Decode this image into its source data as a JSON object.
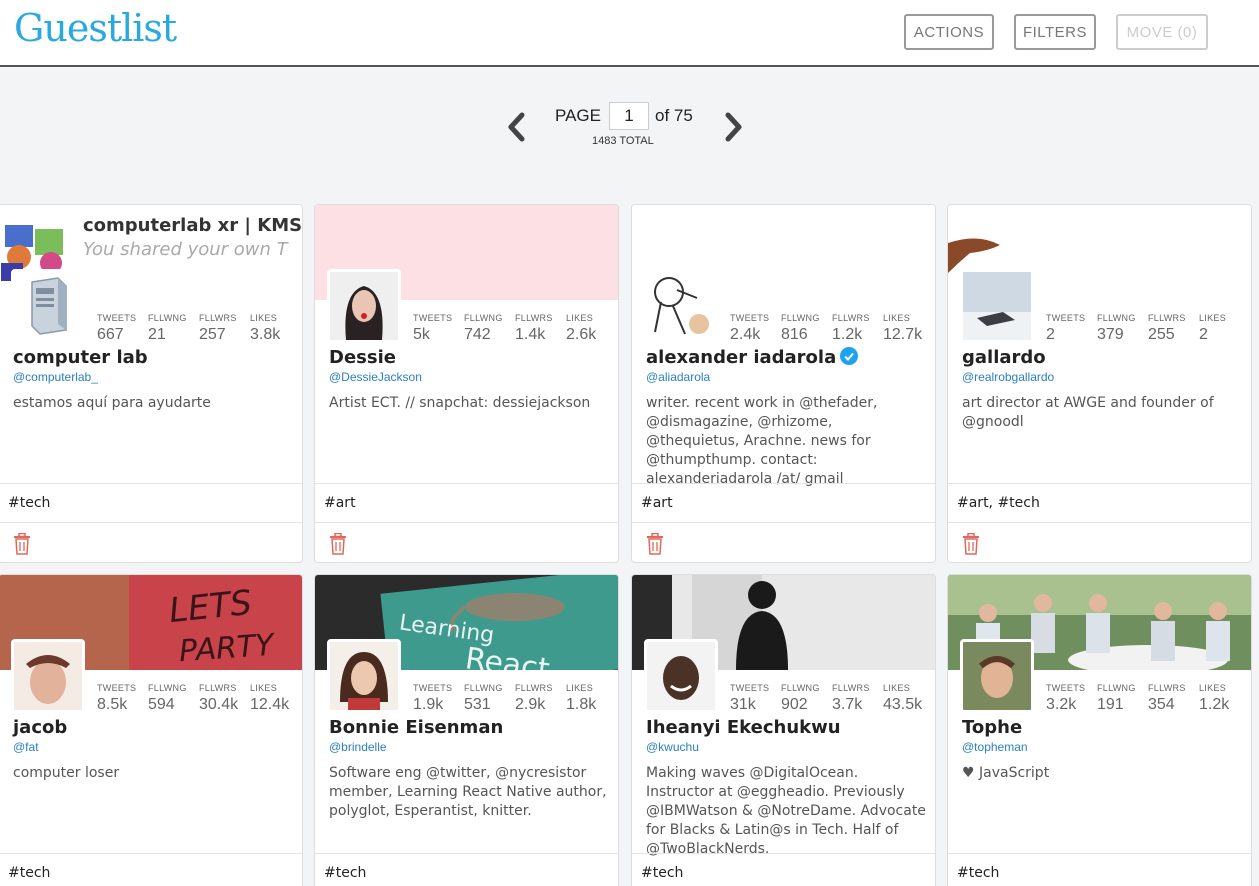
{
  "app": {
    "title": "Guestlist"
  },
  "header": {
    "actions_label": "ACTIONS",
    "filters_label": "FILTERS",
    "move_label": "MOVE (0)"
  },
  "pagination": {
    "page_label": "PAGE",
    "current_page": "1",
    "of_text": "of 75",
    "total_text": "1483 TOTAL"
  },
  "stat_labels": {
    "tweets": "TWEETS",
    "following": "FLLWNG",
    "followers": "FLLWRS",
    "likes": "LIKES"
  },
  "cards": [
    {
      "name": "computer lab",
      "handle": "@computerlab_",
      "tweets": "667",
      "following": "21",
      "followers": "257",
      "likes": "3.8k",
      "bio": "estamos aquí para ayudarte",
      "tags": "#tech",
      "banner_text_1": "computerlab xr | KMS",
      "banner_text_2": "You shared your own T"
    },
    {
      "name": "Dessie",
      "handle": "@DessieJackson",
      "tweets": "5k",
      "following": "742",
      "followers": "1.4k",
      "likes": "2.6k",
      "bio": "Artist ECT. // snapchat: dessiejackson",
      "tags": "#art"
    },
    {
      "name": "alexander iadarola",
      "handle": "@aliadarola",
      "tweets": "2.4k",
      "following": "816",
      "followers": "1.2k",
      "likes": "12.7k",
      "bio": "writer. recent work in @thefader, @dismagazine, @rhizome, @thequietus, Arachne. news for @thumpthump. contact: alexanderiadarola /at/ gmail",
      "tags": "#art",
      "verified": true
    },
    {
      "name": "gallardo",
      "handle": "@realrobgallardo",
      "tweets": "2",
      "following": "379",
      "followers": "255",
      "likes": "2",
      "bio": "art director at AWGE and founder of @gnoodl",
      "tags": "#art, #tech"
    },
    {
      "name": "jacob",
      "handle": "@fat",
      "tweets": "8.5k",
      "following": "594",
      "followers": "30.4k",
      "likes": "12.4k",
      "bio": "computer loser",
      "tags": "#tech",
      "banner_text_1": "LETS",
      "banner_text_2": "PARTY"
    },
    {
      "name": "Bonnie Eisenman",
      "handle": "@brindelle",
      "tweets": "1.9k",
      "following": "531",
      "followers": "2.9k",
      "likes": "1.8k",
      "bio": "Software eng @twitter, @nycresistor member, Learning React Native author, polyglot, Esperantist, knitter.",
      "tags": "#tech",
      "banner_text_1": "Learning",
      "banner_text_2": "React"
    },
    {
      "name": "Iheanyi Ekechukwu",
      "handle": "@kwuchu",
      "tweets": "31k",
      "following": "902",
      "followers": "3.7k",
      "likes": "43.5k",
      "bio": "Making waves @DigitalOcean. Instructor at @eggheadio. Previously @IBMWatson & @NotreDame. Advocate for Blacks & Latin@s in Tech. Half of @TwoBlackNerds.",
      "tags": "#tech"
    },
    {
      "name": "Tophe",
      "handle": "@topheman",
      "tweets": "3.2k",
      "following": "191",
      "followers": "354",
      "likes": "1.2k",
      "bio": "♥ JavaScript",
      "tags": "#tech"
    }
  ],
  "colors": {
    "brand": "#2aa8e0",
    "handle": "#2a7fc1",
    "trash": "#e0685a",
    "verified": "#1da1f2"
  },
  "icons": {
    "prev": "chevron-left-icon",
    "next": "chevron-right-icon",
    "delete": "trash-icon",
    "verified": "verified-badge-icon"
  }
}
